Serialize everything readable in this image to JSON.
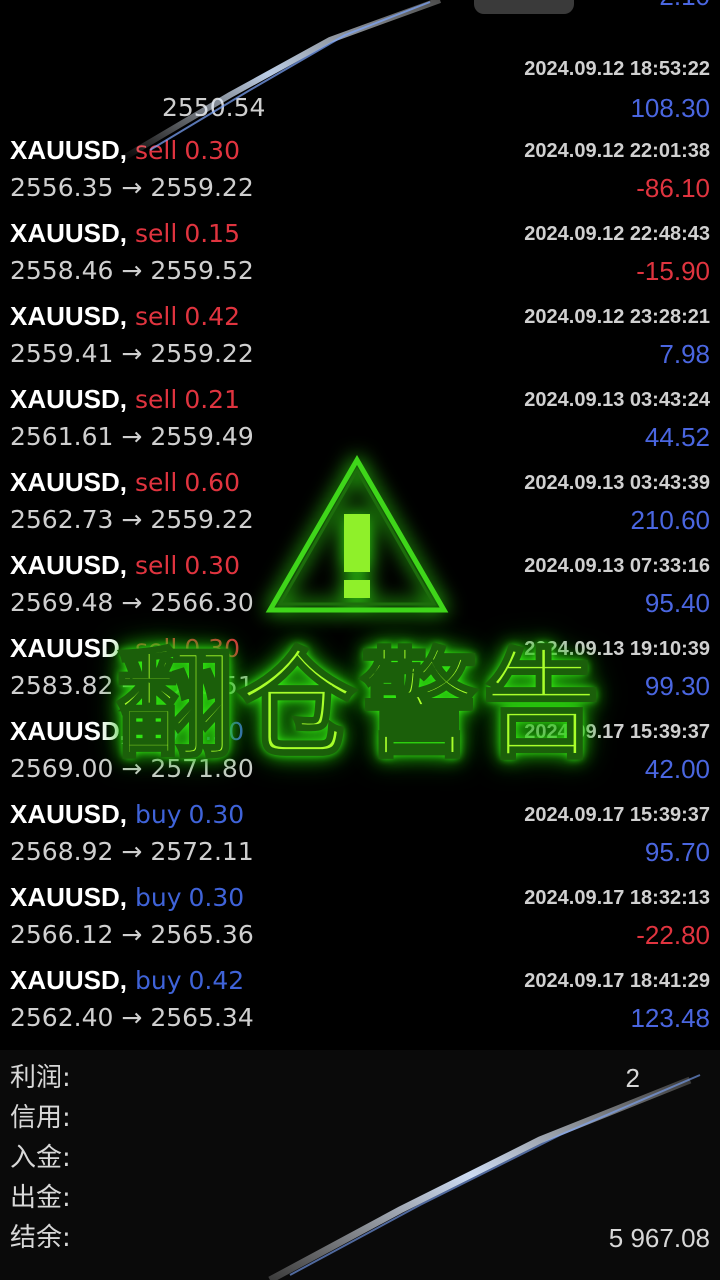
{
  "top_partial": {
    "profit_cut": "2.10",
    "time": "2024.09.12 18:53:22",
    "price_to": "2550.54",
    "profit": "108.30"
  },
  "trades": [
    {
      "symbol": "XAUUSD,",
      "side": "sell",
      "volume": "0.30",
      "time": "2024.09.12 22:01:38",
      "open": "2556.35",
      "close": "2559.22",
      "profit": "-86.10",
      "positive": false
    },
    {
      "symbol": "XAUUSD,",
      "side": "sell",
      "volume": "0.15",
      "time": "2024.09.12 22:48:43",
      "open": "2558.46",
      "close": "2559.52",
      "profit": "-15.90",
      "positive": false
    },
    {
      "symbol": "XAUUSD,",
      "side": "sell",
      "volume": "0.42",
      "time": "2024.09.12 23:28:21",
      "open": "2559.41",
      "close": "2559.22",
      "profit": "7.98",
      "positive": true
    },
    {
      "symbol": "XAUUSD,",
      "side": "sell",
      "volume": "0.21",
      "time": "2024.09.13 03:43:24",
      "open": "2561.61",
      "close": "2559.49",
      "profit": "44.52",
      "positive": true
    },
    {
      "symbol": "XAUUSD,",
      "side": "sell",
      "volume": "0.60",
      "time": "2024.09.13 03:43:39",
      "open": "2562.73",
      "close": "2559.22",
      "profit": "210.60",
      "positive": true
    },
    {
      "symbol": "XAUUSD,",
      "side": "sell",
      "volume": "0.30",
      "time": "2024.09.13 07:33:16",
      "open": "2569.48",
      "close": "2566.30",
      "profit": "95.40",
      "positive": true
    },
    {
      "symbol": "XAUUSD,",
      "side": "sell",
      "volume": "0.30",
      "time": "2024.09.13 19:10:39",
      "open": "2583.82",
      "close": "2580.51",
      "profit": "99.30",
      "positive": true
    },
    {
      "symbol": "XAUUSD,",
      "side": "buy",
      "volume": "0.30",
      "time": "2024.09.17 15:39:37",
      "open": "2569.00",
      "close": "2571.80",
      "profit": "42.00",
      "positive": true
    },
    {
      "symbol": "XAUUSD,",
      "side": "buy",
      "volume": "0.30",
      "time": "2024.09.17 15:39:37",
      "open": "2568.92",
      "close": "2572.11",
      "profit": "95.70",
      "positive": true
    },
    {
      "symbol": "XAUUSD,",
      "side": "buy",
      "volume": "0.30",
      "time": "2024.09.17 18:32:13",
      "open": "2566.12",
      "close": "2565.36",
      "profit": "-22.80",
      "positive": false
    },
    {
      "symbol": "XAUUSD,",
      "side": "buy",
      "volume": "0.42",
      "time": "2024.09.17 18:41:29",
      "open": "2562.40",
      "close": "2565.34",
      "profit": "123.48",
      "positive": true
    }
  ],
  "arrow": "→",
  "summary": {
    "profit_label": "利润:",
    "profit_value": "2",
    "credit_label": "信用:",
    "deposit_label": "入金:",
    "withdraw_label": "出金:",
    "balance_label": "结余:",
    "balance_value": "5 967.08"
  },
  "overlay": {
    "warning_title": "翻仓警告",
    "warning_symbol": "!",
    "glow_color": "#39ff14"
  },
  "colors": {
    "sell": "#e0343f",
    "buy": "#3f63d8",
    "profit_positive": "#4a66e0",
    "profit_negative": "#e0343f"
  }
}
